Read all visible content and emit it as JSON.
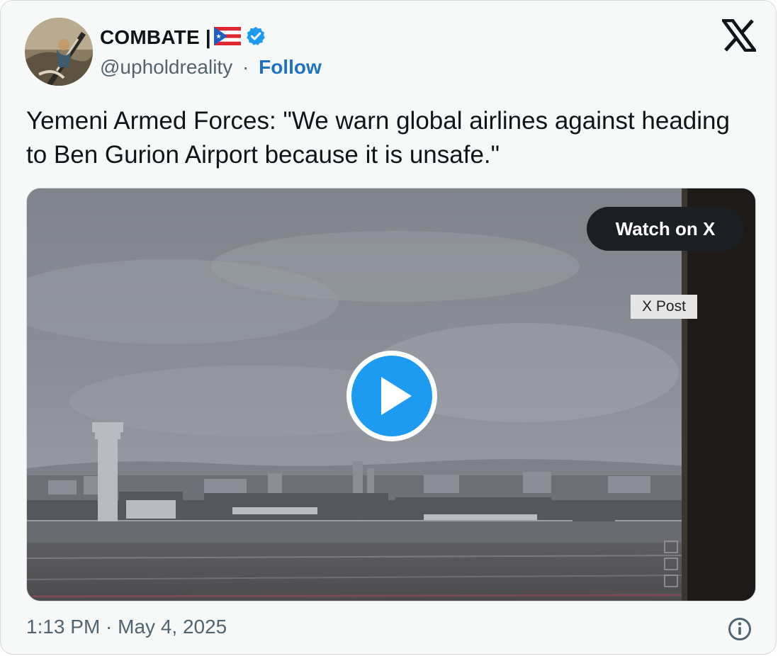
{
  "author": {
    "name": "COMBATE |",
    "handle": "@upholdreality",
    "separator": "·",
    "follow_label": "Follow"
  },
  "tweet": {
    "text": "Yemeni Armed Forces: \"We warn global airlines against heading to Ben Gurion Airport because it is unsafe.\""
  },
  "media": {
    "watch_label": "Watch on X",
    "badge_label": "X Post"
  },
  "footer": {
    "timestamp": "1:13 PM · May 4, 2025"
  },
  "icons": {
    "flag": "puerto-rico-flag-icon",
    "verified": "verified-badge-icon",
    "logo": "x-logo-icon",
    "play": "play-icon",
    "info": "info-icon"
  },
  "colors": {
    "follow": "#1d72c2",
    "verified": "#1d9bf0",
    "play": "#1d9bf0",
    "text": "#0f1419",
    "secondary": "#536471"
  }
}
